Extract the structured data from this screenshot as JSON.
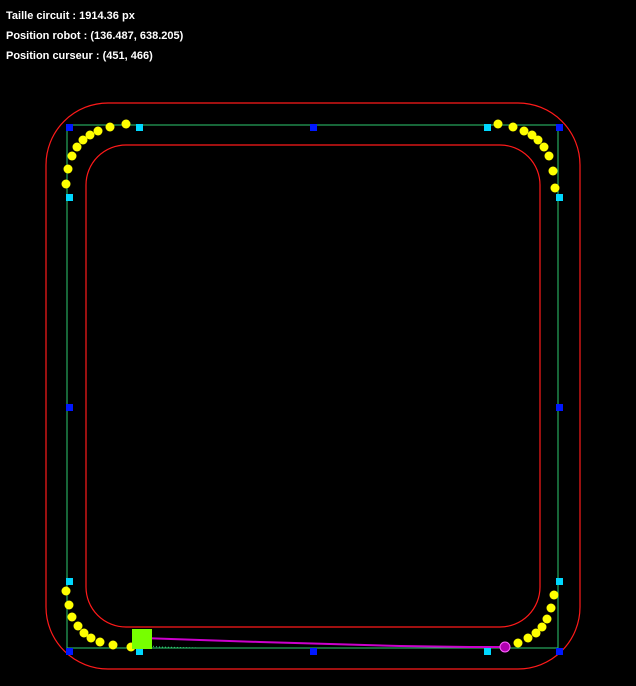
{
  "info": {
    "track_length_label": "Taille circuit :",
    "track_length_value": "1914.36 px",
    "robot_position_label": "Position robot :",
    "robot_position_value": "(136.487, 638.205)",
    "cursor_position_label": "Position curseur :",
    "cursor_position_value": "(451, 466)"
  },
  "colors": {
    "background": "#000000",
    "track_border": "#ff1a1a",
    "centerline": "#2ecc71",
    "control_point": "#0018ff",
    "handle_point": "#00d8ff",
    "corner_marker": "#ffff00",
    "robot": "#77ff00",
    "planned_path": "#cc00cc",
    "target": "#b000b0"
  },
  "icons": {
    "robot": "square-robot-icon",
    "target": "circle-target-icon"
  }
}
